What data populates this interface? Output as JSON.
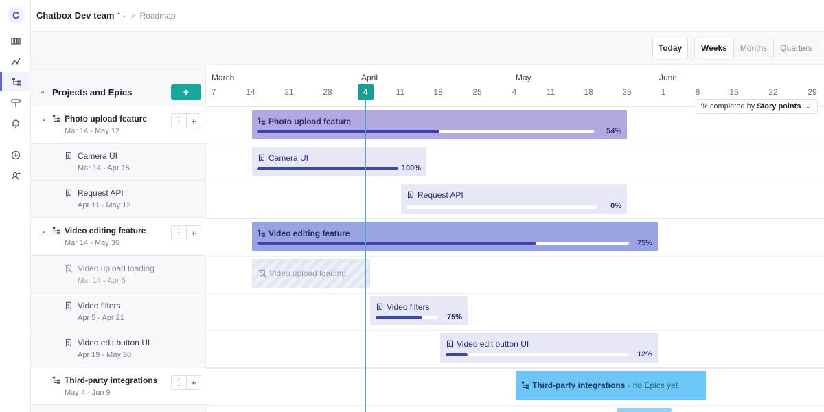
{
  "app": {
    "logo_letter": "C",
    "team": "Chatbox Dev team",
    "breadcrumb_separator": ">",
    "breadcrumb_page": "Roadmap"
  },
  "rail": {
    "items": [
      {
        "icon": "board-icon"
      },
      {
        "icon": "chart-icon"
      },
      {
        "icon": "roadmap-icon",
        "active": true
      },
      {
        "icon": "milestone-icon"
      },
      {
        "icon": "bell-icon"
      },
      {
        "icon": "add-circle-icon"
      },
      {
        "icon": "add-user-icon"
      }
    ]
  },
  "toolbar": {
    "today_label": "Today",
    "scale_options": [
      "Weeks",
      "Months",
      "Quarters"
    ],
    "selected_scale": "Weeks"
  },
  "left": {
    "header_title": "Projects and Epics",
    "add_label": "+",
    "more_label": "⋮",
    "plus_label": "+"
  },
  "timeline": {
    "months": [
      "March",
      "April",
      "May",
      "June"
    ],
    "days": [
      "7",
      "14",
      "21",
      "28",
      "4",
      "11",
      "18",
      "25",
      "4",
      "11",
      "18",
      "25",
      "1",
      "8",
      "15",
      "22",
      "29"
    ],
    "today_day": "4",
    "percent_select": {
      "prefix": "% completed by",
      "value": "Story points"
    }
  },
  "rows": [
    {
      "type": "project",
      "name": "Photo upload feature",
      "dates": "Mar 14 - May 12",
      "bar_label": "Photo upload feature",
      "progress": 54,
      "progress_label": "54%"
    },
    {
      "type": "epic",
      "name": "Camera UI",
      "dates": "Mar 14 - Apr 15",
      "bar_label": "Camera UI",
      "progress": 100,
      "progress_label": "100%"
    },
    {
      "type": "epic",
      "name": "Request API",
      "dates": "Apr 11 - May 12",
      "bar_label": "Request API",
      "progress": 0,
      "progress_label": "0%"
    },
    {
      "type": "project",
      "name": "Video editing feature",
      "dates": "Mar 14 - May 30",
      "bar_label": "Video editing feature",
      "progress": 75,
      "progress_label": "75%"
    },
    {
      "type": "epic-dim",
      "name": "Video upload loading",
      "dates": "Mar 14 - Apr 5",
      "bar_label": "Video upload loading"
    },
    {
      "type": "epic",
      "name": "Video filters",
      "dates": "Apr 5 - Apr 21",
      "bar_label": "Video filters",
      "progress": 75,
      "progress_label": "75%"
    },
    {
      "type": "epic",
      "name": "Video edit button UI",
      "dates": "Apr 19 - May 30",
      "bar_label": "Video edit button UI",
      "progress": 12,
      "progress_label": "12%"
    },
    {
      "type": "project",
      "name": "Third-party integrations",
      "dates": "May 4 - Jun 9",
      "bar_label": "Third-party integrations",
      "bar_note": "- no Epics yet"
    }
  ],
  "colors": {
    "accent_teal": "#18a89a",
    "today_line": "#4aa8c4",
    "project_purple": "#b3a8e0",
    "project_blue": "#9aa3e4",
    "epic_light": "#e7e8f6",
    "progress_dark": "#3f44a8",
    "integration_blue": "#6cc7f5"
  }
}
